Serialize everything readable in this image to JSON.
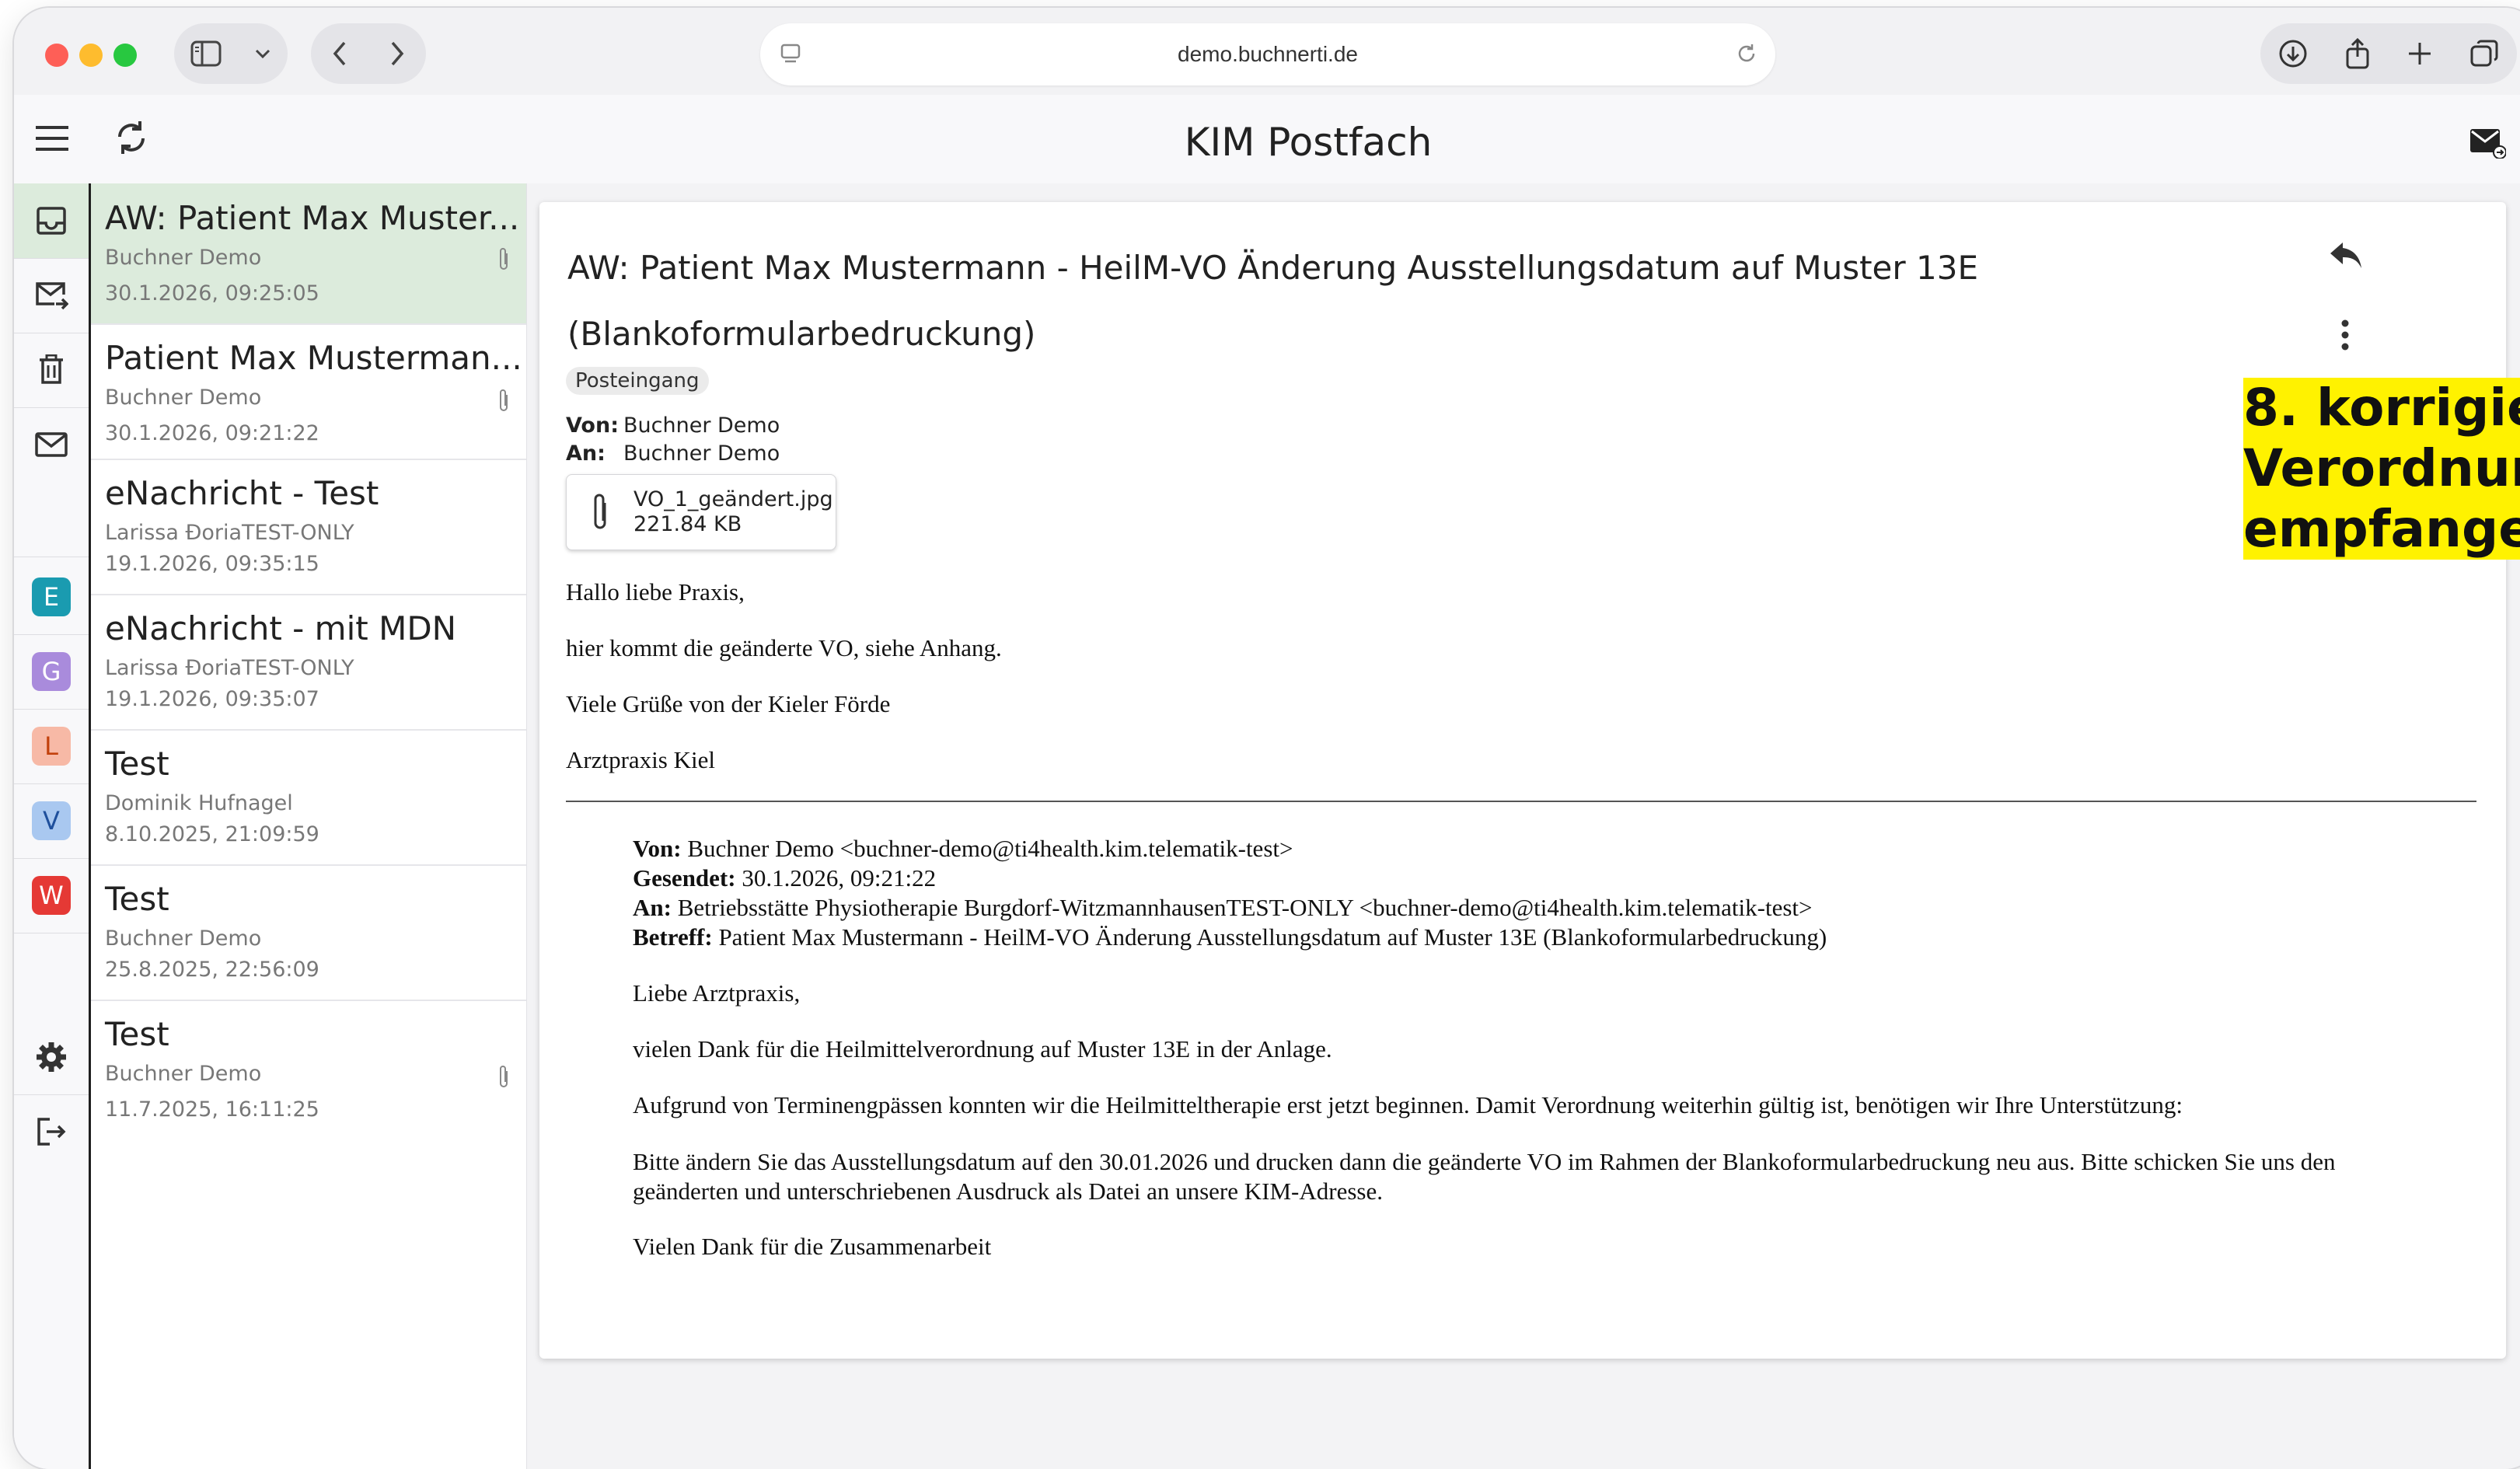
{
  "browser": {
    "url": "demo.buchnerti.de"
  },
  "app": {
    "title": "KIM Postfach"
  },
  "rail": {
    "badges": [
      {
        "letter": "E",
        "color": "#1a9bb0"
      },
      {
        "letter": "G",
        "color": "#a98bdc"
      },
      {
        "letter": "L",
        "color": "#f7b9a6"
      },
      {
        "letter": "V",
        "color": "#a9c8f0"
      },
      {
        "letter": "W",
        "color": "#e53935"
      }
    ]
  },
  "messages": [
    {
      "subject": "AW: Patient Max Muster...",
      "sender": "Buchner Demo",
      "date": "30.1.2026, 09:25:05",
      "attachment": true
    },
    {
      "subject": "Patient Max Musterman...",
      "sender": "Buchner Demo",
      "date": "30.1.2026, 09:21:22",
      "attachment": true
    },
    {
      "subject": "eNachricht - Test",
      "sender": "Larissa ĐoriaTEST-ONLY",
      "date": "19.1.2026, 09:35:15",
      "attachment": false
    },
    {
      "subject": "eNachricht - mit MDN",
      "sender": "Larissa ĐoriaTEST-ONLY",
      "date": "19.1.2026, 09:35:07",
      "attachment": false
    },
    {
      "subject": "Test",
      "sender": "Dominik Hufnagel",
      "date": "8.10.2025, 21:09:59",
      "attachment": false
    },
    {
      "subject": "Test",
      "sender": "Buchner Demo",
      "date": "25.8.2025, 22:56:09",
      "attachment": false
    },
    {
      "subject": "Test",
      "sender": "Buchner Demo",
      "date": "11.7.2025, 16:11:25",
      "attachment": true
    }
  ],
  "mail": {
    "subject_line1": "AW: Patient Max Mustermann - HeilM-VO Änderung Ausstellungsdatum auf Muster 13E",
    "subject_line2": "(Blankoformularbedruckung)",
    "folder": "Posteingang",
    "from_label": "Von:",
    "from": "Buchner Demo",
    "to_label": "An:",
    "to": "Buchner Demo",
    "attachment_name": "VO_1_geändert.jpg",
    "attachment_size": "221.84 KB",
    "body": [
      "Hallo liebe Praxis,",
      "hier kommt die geänderte VO, siehe Anhang.",
      "Viele Grüße von der Kieler Förde",
      "Arztpraxis Kiel"
    ],
    "quoted": {
      "from_label": "Von:",
      "from": "Buchner Demo <buchner-demo@ti4health.kim.telematik-test>",
      "sent_label": "Gesendet:",
      "sent": "30.1.2026, 09:21:22",
      "to_label": "An:",
      "to": "Betriebsstätte Physiotherapie Burgdorf-WitzmannhausenTEST-ONLY <buchner-demo@ti4health.kim.telematik-test>",
      "subject_label": "Betreff:",
      "subject": "Patient Max Mustermann - HeilM-VO Änderung Ausstellungsdatum auf Muster 13E (Blankoformularbedruckung)",
      "greeting": "Liebe Arztpraxis,",
      "p1": "vielen Dank für die Heilmittelverordnung auf Muster 13E in der Anlage.",
      "p2": "Aufgrund von Terminengpässen konnten wir die Heilmitteltherapie erst jetzt beginnen. Damit Verordnung weiterhin gültig ist, benötigen wir Ihre Unterstützung:",
      "p3": "Bitte ändern Sie das Ausstellungsdatum auf den 30.01.2026 und drucken dann die geänderte VO im Rahmen der Blankoformularbedruckung neu aus. Bitte schicken Sie uns den geänderten und unterschriebenen Ausdruck als Datei an unsere KIM-Adresse.",
      "closing": "Vielen Dank für die Zusammenarbeit"
    }
  },
  "annotation": {
    "line1": "8. korrigie",
    "line2": "Verordnun",
    "line3": "empfange",
    "color": "#fff200"
  }
}
